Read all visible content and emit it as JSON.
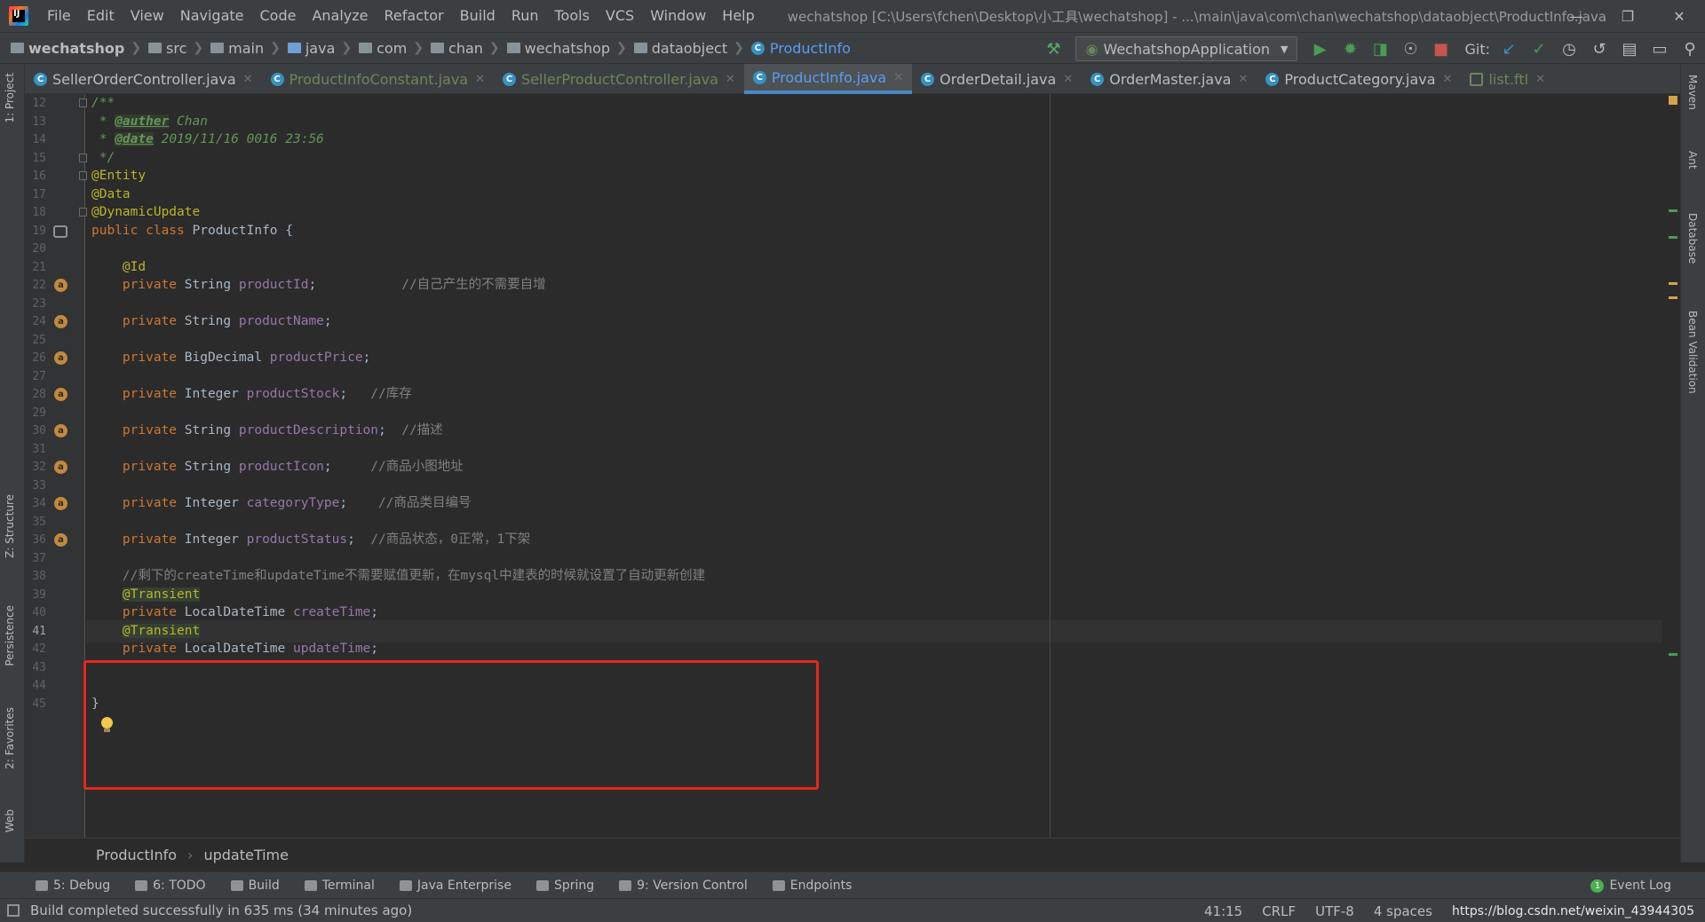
{
  "app": {
    "logo_text": "IJ",
    "menu": [
      "File",
      "Edit",
      "View",
      "Navigate",
      "Code",
      "Analyze",
      "Refactor",
      "Build",
      "Run",
      "Tools",
      "VCS",
      "Window",
      "Help"
    ],
    "window_title": "wechatshop [C:\\Users\\fchen\\Desktop\\小工具\\wechatshop] - ...\\main\\java\\com\\chan\\wechatshop\\dataobject\\ProductInfo.java"
  },
  "nav": {
    "crumbs": [
      "wechatshop",
      "src",
      "main",
      "java",
      "com",
      "chan",
      "wechatshop",
      "dataobject"
    ],
    "current_class": "ProductInfo",
    "run_config": "WechatshopApplication",
    "git_label": "Git:"
  },
  "tabs": [
    {
      "label": "SellerOrderController.java",
      "state": "normal"
    },
    {
      "label": "ProductInfoConstant.java",
      "state": "modified"
    },
    {
      "label": "SellerProductController.java",
      "state": "modified"
    },
    {
      "label": "ProductInfo.java",
      "state": "active"
    },
    {
      "label": "OrderDetail.java",
      "state": "normal"
    },
    {
      "label": "OrderMaster.java",
      "state": "normal"
    },
    {
      "label": "ProductCategory.java",
      "state": "normal"
    },
    {
      "label": "list.ftl",
      "state": "modified"
    }
  ],
  "left_stripe": [
    "1: Project",
    "Z: Structure",
    "Persistence",
    "2: Favorites",
    "Web"
  ],
  "right_stripe": [
    "Maven",
    "Ant",
    "Database",
    "Bean Validation"
  ],
  "editor": {
    "current_line": 41,
    "lines": [
      {
        "n": 12,
        "html": "<span class='tk-doc'>/**</span>"
      },
      {
        "n": 13,
        "html": "<span class='tk-doc'> * </span><span class='tk-doctag'>@auther</span><span class='tk-doc'> Chan</span>"
      },
      {
        "n": 14,
        "html": "<span class='tk-doc'> * </span><span class='tk-doctag'>@date</span><span class='tk-doc'> 2019/11/16 0016 23:56</span>"
      },
      {
        "n": 15,
        "html": "<span class='tk-doc'> */</span>"
      },
      {
        "n": 16,
        "html": "<span class='tk-ann'>@Entity</span>"
      },
      {
        "n": 17,
        "html": "<span class='tk-ann'>@Data</span>"
      },
      {
        "n": 18,
        "html": "<span class='tk-ann'>@DynamicUpdate</span>"
      },
      {
        "n": 19,
        "html": "<span class='tk-kw'>public class </span>ProductInfo {"
      },
      {
        "n": 20,
        "html": ""
      },
      {
        "n": 21,
        "html": "    <span class='tk-ann'>@Id</span>"
      },
      {
        "n": 22,
        "html": "    <span class='tk-kw'>private </span>String <span class='tk-field'>productId</span>;           <span class='tk-cmt'>//自己产生的不需要自增</span>"
      },
      {
        "n": 23,
        "html": ""
      },
      {
        "n": 24,
        "html": "    <span class='tk-kw'>private </span>String <span class='tk-field'>productName</span>;"
      },
      {
        "n": 25,
        "html": ""
      },
      {
        "n": 26,
        "html": "    <span class='tk-kw'>private </span>BigDecimal <span class='tk-field'>productPrice</span>;"
      },
      {
        "n": 27,
        "html": ""
      },
      {
        "n": 28,
        "html": "    <span class='tk-kw'>private </span>Integer <span class='tk-field'>productStock</span>;   <span class='tk-cmt'>//库存</span>"
      },
      {
        "n": 29,
        "html": ""
      },
      {
        "n": 30,
        "html": "    <span class='tk-kw'>private </span>String <span class='tk-field'>productDescription</span>;  <span class='tk-cmt'>//描述</span>"
      },
      {
        "n": 31,
        "html": ""
      },
      {
        "n": 32,
        "html": "    <span class='tk-kw'>private </span>String <span class='tk-field'>productIcon</span>;     <span class='tk-cmt'>//商品小图地址</span>"
      },
      {
        "n": 33,
        "html": ""
      },
      {
        "n": 34,
        "html": "    <span class='tk-kw'>private </span>Integer <span class='tk-field'>categoryType</span>;    <span class='tk-cmt'>//商品类目编号</span>"
      },
      {
        "n": 35,
        "html": ""
      },
      {
        "n": 36,
        "html": "    <span class='tk-kw'>private </span>Integer <span class='tk-field'>productStatus</span>;  <span class='tk-cmt'>//商品状态，0正常，1下架</span>"
      },
      {
        "n": 37,
        "html": ""
      },
      {
        "n": 38,
        "html": "    <span class='tk-cmt'>//剩下的createTime和updateTime不需要赋值更新，在mysql中建表的时候就设置了自动更新创建</span>"
      },
      {
        "n": 39,
        "html": "    <span class='tk-ann-hl'>@Transient</span>"
      },
      {
        "n": 40,
        "html": "    <span class='tk-kw'>private </span>LocalDateTime <span class='tk-field'>createTime</span>;"
      },
      {
        "n": 41,
        "html": "    <span class='tk-ann-hl'>@Transient</span>"
      },
      {
        "n": 42,
        "html": "    <span class='tk-kw'>private </span>LocalDateTime <span class='tk-field'>updateTime</span>;"
      },
      {
        "n": 43,
        "html": ""
      },
      {
        "n": 44,
        "html": ""
      },
      {
        "n": 45,
        "html": "}"
      }
    ],
    "field_marks": [
      22,
      24,
      26,
      28,
      30,
      32,
      34,
      36
    ],
    "field_mark_letter": "a"
  },
  "code_crumbs": [
    "ProductInfo",
    "updateTime"
  ],
  "toolwindows": [
    "5: Debug",
    "6: TODO",
    "Build",
    "Terminal",
    "Java Enterprise",
    "Spring",
    "9: Version Control",
    "Endpoints"
  ],
  "event_log": {
    "label": "Event Log",
    "count": "1"
  },
  "status": {
    "message": "Build completed successfully in 635 ms (34 minutes ago)",
    "position": "41:15",
    "line_sep": "CRLF",
    "encoding": "UTF-8",
    "indent": "4 spaces",
    "watermark": "https://blog.csdn.net/weixin_43944305"
  }
}
